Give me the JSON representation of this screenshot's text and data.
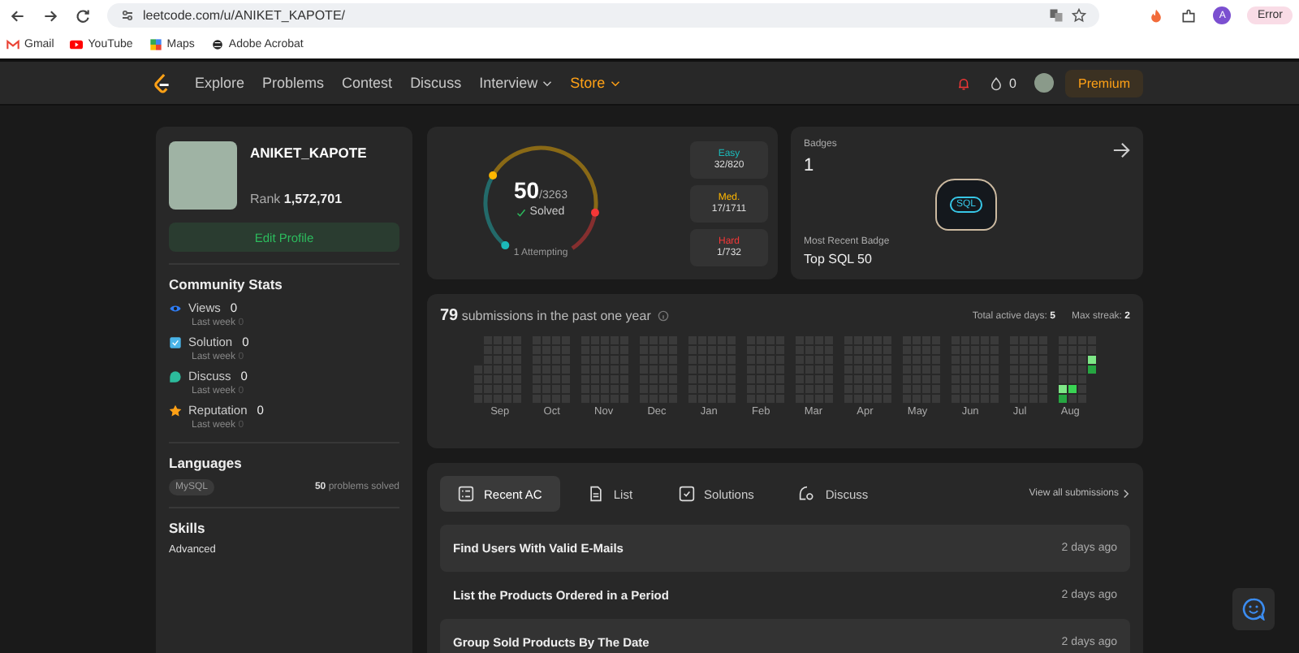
{
  "browser": {
    "url": "leetcode.com/u/ANIKET_KAPOTE/",
    "profile": "A",
    "status": "Error"
  },
  "bookmarks": [
    {
      "label": "Gmail",
      "kind": "mail"
    },
    {
      "label": "YouTube",
      "kind": "video"
    },
    {
      "label": "Maps",
      "kind": "map"
    },
    {
      "label": "Adobe Acrobat",
      "kind": "globe"
    }
  ],
  "nav": {
    "items": [
      {
        "label": "Explore",
        "dropdown": false,
        "highlighted": false
      },
      {
        "label": "Problems",
        "dropdown": false,
        "highlighted": false
      },
      {
        "label": "Contest",
        "dropdown": false,
        "highlighted": false
      },
      {
        "label": "Discuss",
        "dropdown": false,
        "highlighted": false
      },
      {
        "label": "Interview",
        "dropdown": true,
        "highlighted": false
      },
      {
        "label": "Store",
        "dropdown": true,
        "highlighted": true
      }
    ],
    "streak": "0",
    "premium": "Premium"
  },
  "profile": {
    "username": "ANIKET_KAPOTE",
    "rank_label": "Rank",
    "rank": "1,572,701",
    "edit": "Edit Profile"
  },
  "community_stats": {
    "title": "Community Stats",
    "items": [
      {
        "kind": "views",
        "label": "Views",
        "value": "0",
        "sub_label": "Last week",
        "sub_value": "0"
      },
      {
        "kind": "solution",
        "label": "Solution",
        "value": "0",
        "sub_label": "Last week",
        "sub_value": "0"
      },
      {
        "kind": "discuss",
        "label": "Discuss",
        "value": "0",
        "sub_label": "Last week",
        "sub_value": "0"
      },
      {
        "kind": "reputation",
        "label": "Reputation",
        "value": "0",
        "sub_label": "Last week",
        "sub_value": "0"
      }
    ]
  },
  "languages": {
    "title": "Languages",
    "items": [
      {
        "name": "MySQL",
        "count": "50",
        "suffix": "problems solved"
      }
    ]
  },
  "skills": {
    "title": "Skills",
    "items": [
      "Advanced"
    ]
  },
  "solved": {
    "count": "50",
    "total": "/3263",
    "label": "Solved",
    "attempting": "1 Attempting",
    "difficulties": [
      {
        "label": "Easy",
        "value": "32/820",
        "color": "#1cbaba"
      },
      {
        "label": "Med.",
        "value": "17/1711",
        "color": "#ffb700"
      },
      {
        "label": "Hard",
        "value": "1/732",
        "color": "#f63737"
      }
    ]
  },
  "badges": {
    "title": "Badges",
    "count": "1",
    "badge_text": "SQL",
    "recent_label": "Most Recent Badge",
    "recent_name": "Top SQL 50"
  },
  "submissions": {
    "count": "79",
    "text": "submissions in the past one year",
    "active_label": "Total active days:",
    "active": "5",
    "streak_label": "Max streak:",
    "streak": "2",
    "months": [
      "Sep",
      "Oct",
      "Nov",
      "Dec",
      "Jan",
      "Feb",
      "Mar",
      "Apr",
      "May",
      "Jun",
      "Jul",
      "Aug"
    ]
  },
  "recent": {
    "tabs": [
      {
        "label": "Recent AC",
        "kind": "recent",
        "selected": true
      },
      {
        "label": "List",
        "kind": "list",
        "selected": false
      },
      {
        "label": "Solutions",
        "kind": "solutions",
        "selected": false
      },
      {
        "label": "Discuss",
        "kind": "discuss",
        "selected": false
      }
    ],
    "view_all": "View all submissions",
    "rows": [
      {
        "title": "Find Users With Valid E-Mails",
        "time": "2 days ago"
      },
      {
        "title": "List the Products Ordered in a Period",
        "time": "2 days ago"
      },
      {
        "title": "Group Sold Products By The Date",
        "time": "2 days ago"
      }
    ]
  }
}
